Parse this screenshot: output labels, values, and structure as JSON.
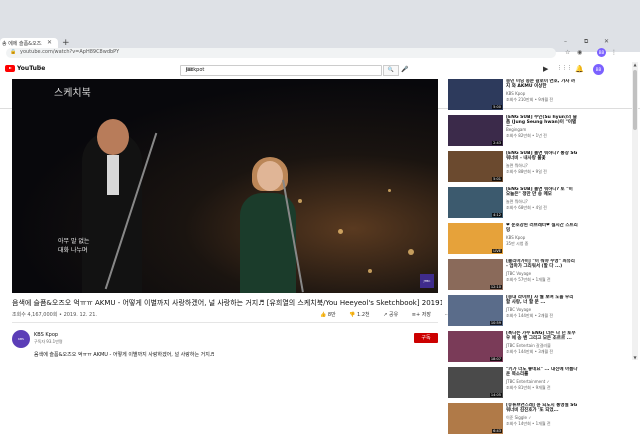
{
  "browser": {
    "tab_title": "송 에에 슬픔&오즈오 벽ㅠㅠ",
    "tab_close": "✕",
    "new_tab": "+",
    "url": "youtube.com/watch?v=ApH89C8wdbPY",
    "window_controls": [
      "–",
      "⧉",
      "✕"
    ]
  },
  "youtube": {
    "logo_text": "YouTube",
    "logo_region": "KR",
    "search_value": "Jackpot",
    "keyboard_icon": "⌨",
    "search_icon": "🔍",
    "mic_icon": "🎤",
    "header_icons": [
      "▶",
      "⋮⋮⋮",
      "🔔"
    ],
    "avatar_initials": "BB"
  },
  "video": {
    "show_logo": "스케치북",
    "subtitle_line1": "아무 말 없는",
    "subtitle_line2": "대화 나누며",
    "channel_bug": "JTBC",
    "title": "음색에 슬픔&오즈오 억ㅠㅠ AKMU - 어떻게 이별까지 사랑하겠어, 널 사랑하는 거지♬ [유희열의 스케치북/You Heeyeol's Sketchbook] 20191220",
    "meta": "조회수 4,167,000회 • 2019. 12. 21.",
    "likes": "8만",
    "dislikes": "1.2천",
    "share_label": "공유",
    "save_label": "저장",
    "more_label": "···"
  },
  "channel": {
    "avatar_text": "KBS",
    "name": "KBS Kpop",
    "subs": "구독자 93.1만명",
    "subscribe_label": "구독",
    "description": "음색에 슬픔&오즈오 억ㅠㅠ AKMU - 어떻게 이별까지 사랑하겠어, 널 사랑하는 거지♬"
  },
  "recommendations": [
    {
      "title": "송민 미닝 송문 갈로이 연호, 가사 까지 와 AKMU 이상한",
      "channel": "KBS Kpop",
      "views": "조회수 210만회 • 9개월 전",
      "duration": "5:00",
      "color": "#2d3a5c"
    },
    {
      "title": "[ENG SUB] 수인(Su hyun)의 슬픔 (Jung Seung hwan)이 \"이별을\"",
      "channel": "Begingam",
      "views": "조회수 82만회 • 1년 전",
      "duration": "2:43",
      "color": "#3b2a4a"
    },
    {
      "title": "[ENG SUB] 놀면 뭐하니? 통장 SG 워너비 - 내사랑 불꽃",
      "channel": "놀면 뭐하니?",
      "views": "조회수 88만회 • 9일 전",
      "duration": "5:01",
      "color": "#6b4a2f"
    },
    {
      "title": "[ENG SUB] 놀면 뭐하니? 토 \"이 오늘은\" 정만 만 송 메모",
      "channel": "놀면 뭐하니?",
      "views": "조회수 68만회 • 4일 전",
      "duration": "4:12",
      "color": "#3c5a6e"
    },
    {
      "title": "❤ 눈호강된 러브레터❤ 실시간 스트리밍",
      "channel": "KBS Kpop",
      "views": "35만 시청 중",
      "duration": "LIVE",
      "color": "#e6a23a"
    },
    {
      "title": "[클리마가이] \"이 뭐야 수영\" 최유리 - 엄마가 그리워서 (할 다 ...)",
      "channel": "JTBC Voyage",
      "views": "조회수 57만회 • 1개월 전",
      "duration": "12:10",
      "color": "#8a6a5a"
    },
    {
      "title": "[송대 라이브] 자 뭘 보며 노을 우리 할 사랑, 너 할 문 ...",
      "channel": "JTBC Voyage",
      "views": "조회수 144만회 • 2개월 전",
      "duration": "10:59",
      "color": "#5a6c8a"
    },
    {
      "title": "[혹나는 가수 ENG] 너는 나 넌 토무 우 에 송 벤 그리고 모든 조르르 ...",
      "channel": "JTBC Entertain 갈걸러블",
      "views": "조회수 144만회 • 3개월 전",
      "duration": "18:07",
      "color": "#7a3b58"
    },
    {
      "title": "\"키가 너도 좋네요\" ... 대신에 아름다운 목소리를",
      "channel": "JTBC Entertainment ✓",
      "views": "조회수 81만회 • 9개월 전",
      "duration": "14:05",
      "color": "#4a4a4a"
    },
    {
      "title": "[유튜브연스레] 윤 되도지 통영설 SG 워너비 김진호가 '또 되었...",
      "channel": "이준 Siggle ✓",
      "views": "조회수 14만회 • 1개월 전",
      "duration": "6:43",
      "color": "#b07a48"
    }
  ]
}
